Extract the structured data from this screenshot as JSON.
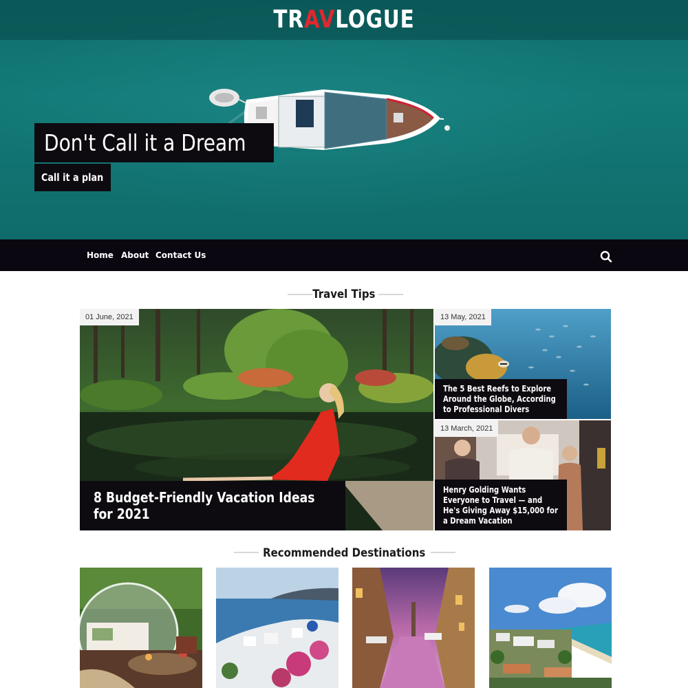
{
  "site": {
    "logo_pre": "TR",
    "logo_accent": "AV",
    "logo_post": "LOGUE",
    "accent_color": "#e0282e"
  },
  "hero": {
    "title": "Don't Call it a Dream",
    "subtitle": "Call it a plan"
  },
  "nav": {
    "items": [
      {
        "label": "Home"
      },
      {
        "label": "About"
      },
      {
        "label": "Contact Us"
      }
    ],
    "search_icon": "search-icon"
  },
  "travel_tips": {
    "heading": "Travel Tips",
    "featured": {
      "date": "01 June, 2021",
      "title": "8 Budget-Friendly Vacation Ideas for 2021"
    },
    "side": [
      {
        "date": "13 May, 2021",
        "title": "The 5 Best Reefs to Explore Around the Globe, According to Professional Divers"
      },
      {
        "date": "13 March, 2021",
        "title": "Henry Golding Wants Everyone to Travel — and He's Giving Away $15,000 for a Dream Vacation"
      }
    ]
  },
  "recommended": {
    "heading": "Recommended Destinations"
  }
}
